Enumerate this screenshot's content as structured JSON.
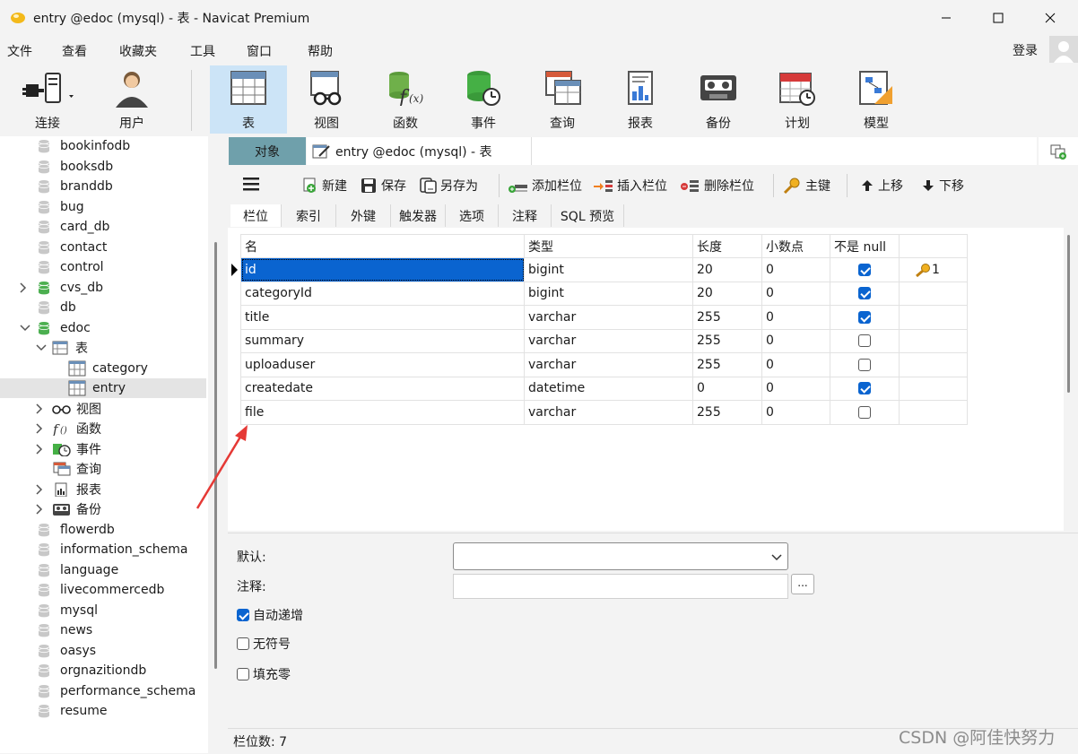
{
  "window": {
    "title": "entry @edoc (mysql) - 表 - Navicat Premium"
  },
  "menu": [
    "文件",
    "查看",
    "收藏夹",
    "工具",
    "窗口",
    "帮助"
  ],
  "login": "登录",
  "toolbar": [
    {
      "label": "连接",
      "icon": "plug-icon"
    },
    {
      "label": "用户",
      "icon": "user-icon"
    },
    {
      "label": "表",
      "icon": "table-icon"
    },
    {
      "label": "视图",
      "icon": "view-icon"
    },
    {
      "label": "函数",
      "icon": "function-icon"
    },
    {
      "label": "事件",
      "icon": "event-icon"
    },
    {
      "label": "查询",
      "icon": "query-icon"
    },
    {
      "label": "报表",
      "icon": "report-icon"
    },
    {
      "label": "备份",
      "icon": "backup-icon"
    },
    {
      "label": "计划",
      "icon": "calendar-icon"
    },
    {
      "label": "模型",
      "icon": "model-icon"
    }
  ],
  "sidebar": {
    "dbs_top": [
      "bookinfodb",
      "booksdb",
      "branddb",
      "bug",
      "card_db",
      "contact",
      "control",
      "cvs_db",
      "db",
      "edoc"
    ],
    "edoc_children": {
      "tables_label": "表",
      "tables": [
        "category",
        "entry"
      ],
      "groups": [
        "视图",
        "函数",
        "事件",
        "查询",
        "报表",
        "备份"
      ]
    },
    "dbs_bottom": [
      "flowerdb",
      "information_schema",
      "language",
      "livecommercedb",
      "mysql",
      "news",
      "oasys",
      "orgnazitiondb",
      "performance_schema",
      "resume"
    ]
  },
  "tabs": {
    "objects": "对象",
    "entry": "entry @edoc (mysql) - 表"
  },
  "editbar": {
    "new": "新建",
    "save": "保存",
    "save_as": "另存为",
    "add_field": "添加栏位",
    "insert_field": "插入栏位",
    "delete_field": "删除栏位",
    "primary_key": "主键",
    "move_up": "上移",
    "move_down": "下移"
  },
  "subtabs": [
    "栏位",
    "索引",
    "外键",
    "触发器",
    "选项",
    "注释",
    "SQL 预览"
  ],
  "grid": {
    "headers": [
      "名",
      "类型",
      "长度",
      "小数点",
      "不是 null",
      ""
    ],
    "rows": [
      {
        "name": "id",
        "type": "bigint",
        "length": "20",
        "decimals": "0",
        "not_null": true,
        "key": "1"
      },
      {
        "name": "categoryId",
        "type": "bigint",
        "length": "20",
        "decimals": "0",
        "not_null": true,
        "key": ""
      },
      {
        "name": "title",
        "type": "varchar",
        "length": "255",
        "decimals": "0",
        "not_null": true,
        "key": ""
      },
      {
        "name": "summary",
        "type": "varchar",
        "length": "255",
        "decimals": "0",
        "not_null": false,
        "key": ""
      },
      {
        "name": "uploaduser",
        "type": "varchar",
        "length": "255",
        "decimals": "0",
        "not_null": false,
        "key": ""
      },
      {
        "name": "createdate",
        "type": "datetime",
        "length": "0",
        "decimals": "0",
        "not_null": true,
        "key": ""
      },
      {
        "name": "file",
        "type": "varchar",
        "length": "255",
        "decimals": "0",
        "not_null": false,
        "key": ""
      }
    ]
  },
  "props": {
    "default_label": "默认:",
    "default_value": "",
    "comment_label": "注释:",
    "comment_value": "",
    "more_label": "...",
    "auto_increment": {
      "label": "自动递增",
      "checked": true
    },
    "unsigned": {
      "label": "无符号",
      "checked": false
    },
    "zerofill": {
      "label": "填充零",
      "checked": false
    }
  },
  "status": "栏位数: 7",
  "watermark": "CSDN @阿佳快努力",
  "colors": {
    "accent": "#0a64d0",
    "active_tab": "#6fa0ab",
    "toolbar_active": "#cce4f7",
    "arrow": "#e53935"
  }
}
